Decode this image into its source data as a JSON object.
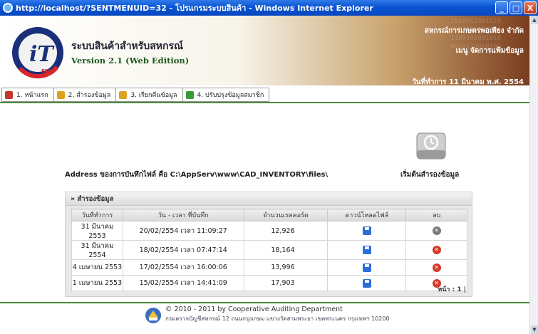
{
  "window": {
    "title": "http://localhost/?SENTMENUID=32 - โปรแกรมระบบสินค้า - Windows Internet Explorer",
    "min_label": "_",
    "max_label": "□",
    "close_label": "X"
  },
  "header": {
    "app_title": "ระบบสินค้าสำหรับสหกรณ์",
    "version": "Version 2.1 (Web Edition)",
    "organization": "สหกรณ์การเกษตรพอเพียง จำกัด",
    "module": "เมนู จัดการแฟ้มข้อมูล",
    "work_date": "วันที่ทำการ 11 มีนาคม พ.ศ. 2554",
    "logo_text": "iT",
    "logo_ring_text": "FAS"
  },
  "menu": [
    {
      "label": "1. หน้าแรก",
      "icon": "home-icon",
      "color": "#c0392b"
    },
    {
      "label": "2. สำรองข้อมูล",
      "icon": "backup-folder-icon",
      "color": "#d9a520"
    },
    {
      "label": "3. เรียกคืนข้อมูล",
      "icon": "restore-folder-icon",
      "color": "#d9a520"
    },
    {
      "label": "4. ปรับปรุงข้อมูลสมาชิก",
      "icon": "update-members-icon",
      "color": "#3a9a3a"
    }
  ],
  "content": {
    "address": "Address ของการบันทึกไฟล์ คือ C:\\AppServ\\www\\CAD_INVENTORY\\files\\",
    "start_backup_label": "เริ่มต้นสำรองข้อมูล"
  },
  "table": {
    "panel_title": "» สำรองข้อมูล",
    "columns": [
      "วันที่ทำการ",
      "วัน - เวลา ที่บันทึก",
      "จำนวนเรคคอร์ด",
      "ดาวน์โหลดไฟล์",
      "ลบ"
    ],
    "rows": [
      {
        "work_date": "31 มีนาคม 2553",
        "saved_at": "20/02/2554   เวลา 11:09:27",
        "records": "12,926",
        "delete_style": "grey"
      },
      {
        "work_date": "31 มีนาคม 2554",
        "saved_at": "18/02/2554   เวลา 07:47:14",
        "records": "18,164",
        "delete_style": "red"
      },
      {
        "work_date": "4 เมษายน 2553",
        "saved_at": "17/02/2554   เวลา 16:00:06",
        "records": "13,996",
        "delete_style": "red"
      },
      {
        "work_date": "1 เมษายน 2553",
        "saved_at": "15/02/2554   เวลา 14:41:09",
        "records": "17,903",
        "delete_style": "red"
      }
    ],
    "pager": "หน้า : 1 |"
  },
  "footer": {
    "copyright": "© 2010 - 2011  by Cooperative Auditing Department",
    "address": "กรมตรวจบัญชีสหกรณ์ 12 ถนนกรุงเกษม แขวงวัดสามพระยา เขตพระนคร กรุงเทพฯ 10200"
  }
}
